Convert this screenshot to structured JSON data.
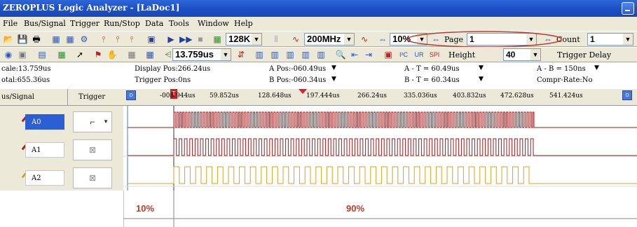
{
  "window": {
    "title": "ZEROPLUS Logic Analyzer - [LaDoc1]"
  },
  "menu": [
    "File",
    "Bus/Signal",
    "Trigger",
    "Run/Stop",
    "Data",
    "Tools",
    "Window",
    "Help"
  ],
  "toolbar1": {
    "memory_depth": "128K",
    "sample_rate": "200MHz",
    "zoom_percent": "10%",
    "page_label": "Page",
    "page_value": "1",
    "count_label": "Count",
    "count_value": "1"
  },
  "toolbar2": {
    "time_value": "13.759us",
    "height_label": "Height",
    "height_value": "40",
    "trigger_delay_label": "Trigger Delay"
  },
  "status": {
    "scale": "cale:13.759us",
    "total": "otal:655.36us",
    "display_pos": "Display Pos:266.24us",
    "trigger_pos": "Trigger Pos:0ns",
    "a_pos": "A Pos:-060.49us",
    "b_pos": "B Pos:-060.34us",
    "a_minus_t": "A - T = 60.49us",
    "b_minus_t": "B - T = 60.34us",
    "a_minus_b": "A - B = 150ns",
    "compr_rate": "Compr-Rate:No"
  },
  "channel_panel": {
    "signal_header": "us/Signal",
    "trigger_header": "Trigger",
    "channels": [
      {
        "name": "A0",
        "selected": true
      },
      {
        "name": "A1",
        "selected": false
      },
      {
        "name": "A2",
        "selected": false
      }
    ]
  },
  "ruler": {
    "ticks": [
      "-008.944us",
      "59.852us",
      "128.648us",
      "197.444us",
      "266.24us",
      "335.036us",
      "403.832us",
      "472.628us",
      "541.424us"
    ]
  },
  "annotation": {
    "left_pct": "10%",
    "right_pct": "90%"
  },
  "colors": {
    "titlebar": "#1b4fc4",
    "waveform": "#9b1b1b",
    "a2_waveform": "#e0a020",
    "annotation": "#c0392b",
    "selected": "#2c5fd4"
  }
}
